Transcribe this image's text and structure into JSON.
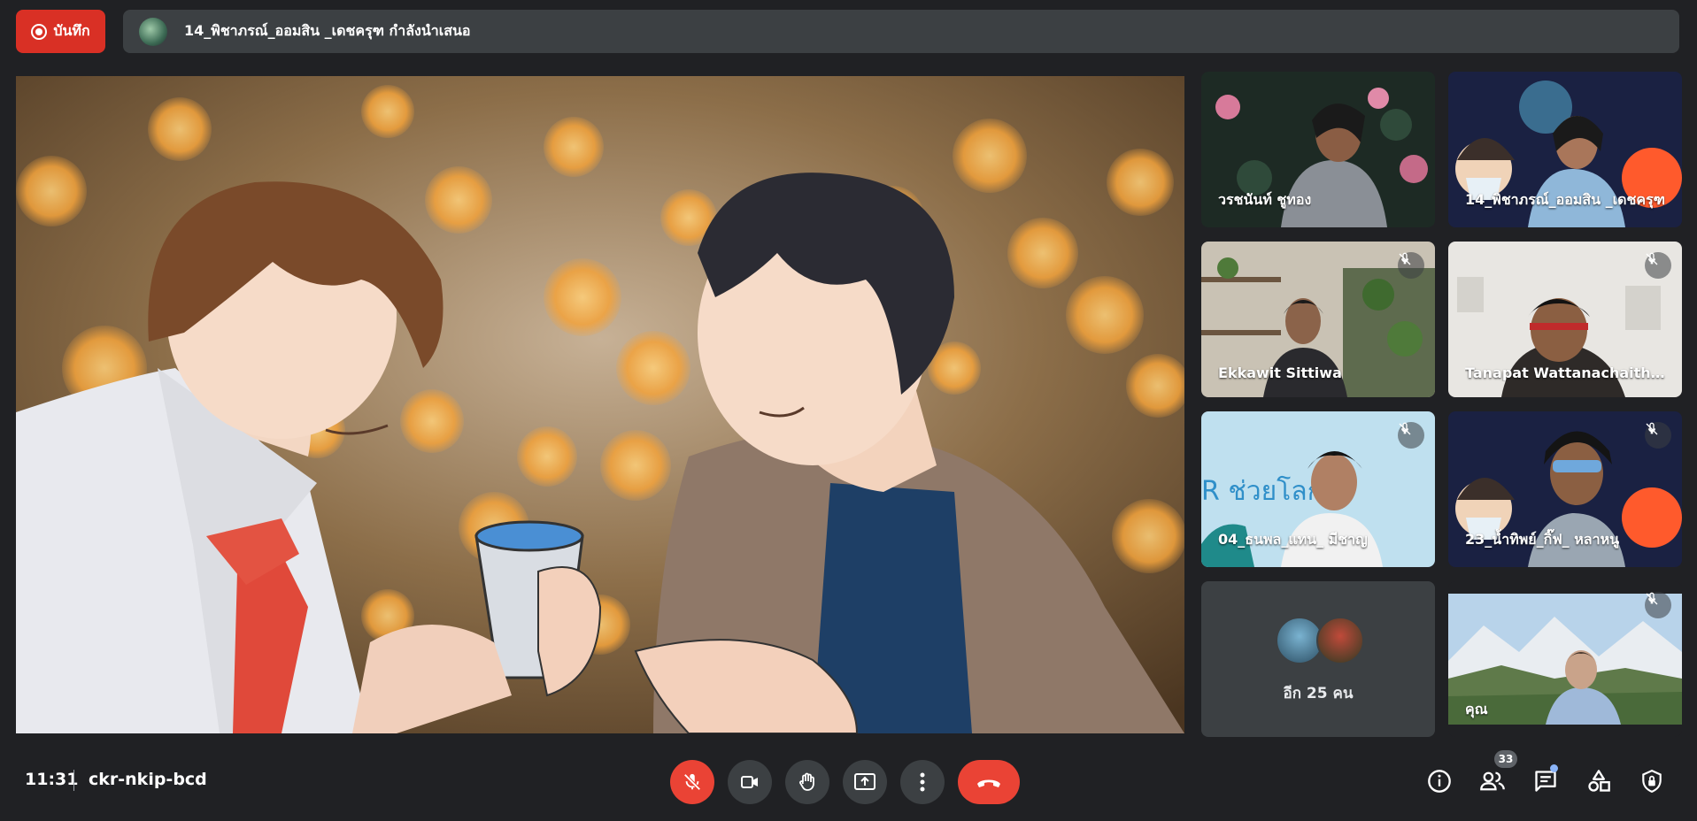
{
  "header": {
    "record_label": "บันทึก",
    "presenter_text": "14_พิชาภรณ์_ออมสิน _เดชครุฑ กำลังนำเสนอ"
  },
  "participants": [
    {
      "name": "วรชนันท์ ชูทอง",
      "muted": false
    },
    {
      "name": "14_พิชาภรณ์_ออมสิน _เดชครุฑ",
      "muted": false
    },
    {
      "name": "Ekkawit Sittiwa",
      "muted": true
    },
    {
      "name": "Tanapat Wattanachaitham",
      "muted": true
    },
    {
      "name": "04_ธนพล_แทน_ มีชาญ",
      "muted": true
    },
    {
      "name": "23_น้ำทิพย์_กิ๊ฟ_ หลาหนู",
      "muted": true
    },
    {
      "name": "คุณ",
      "muted": true
    }
  ],
  "more_tile": {
    "label": "อีก 25 คน"
  },
  "bottom_bar": {
    "time": "11:31",
    "meeting_code": "ckr-nkip-bcd",
    "participant_count": "33"
  },
  "controls": {
    "mic": "mic-off-icon",
    "camera": "video-camera-icon",
    "raise_hand": "hand-icon",
    "present": "present-screen-icon",
    "more": "more-vert-icon",
    "leave": "phone-hangup-icon"
  },
  "right_icons": [
    "info-icon",
    "people-icon",
    "chat-icon",
    "activities-icon",
    "host-controls-icon"
  ],
  "colors": {
    "background": "#202124",
    "surface": "#3c4043",
    "danger": "#ea4335",
    "record": "#d93025",
    "accent": "#8ab4f8"
  }
}
